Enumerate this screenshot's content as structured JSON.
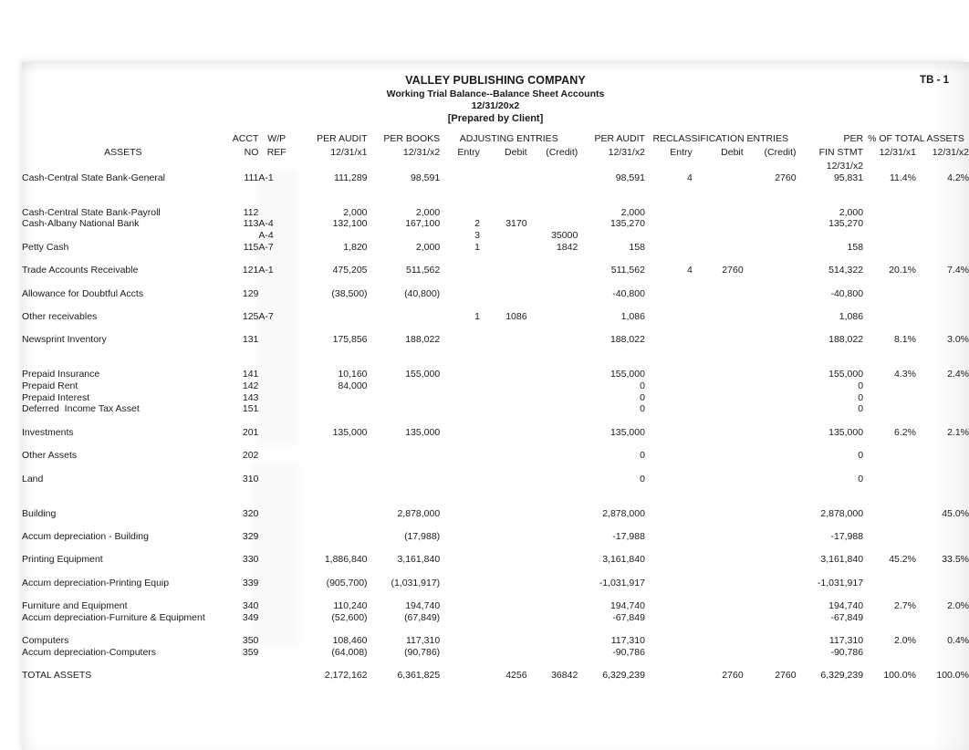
{
  "document": {
    "company": "VALLEY PUBLISHING COMPANY",
    "subtitle": "Working Trial Balance--Balance Sheet Accounts",
    "date": "12/31/20x2",
    "prepared_by": "[Prepared by Client]",
    "page_ref": "TB - 1"
  },
  "headers": {
    "assets": "ASSETS",
    "acct_no_1": "ACCT",
    "acct_no_2": "NO",
    "wp_ref_1": "W/P",
    "wp_ref_2": "REF",
    "per_audit_x1_1": "PER AUDIT",
    "per_audit_x1_2": "12/31/x1",
    "per_books_x2_1": "PER BOOKS",
    "per_books_x2_2": "12/31/x2",
    "adjusting_entries": "ADJUSTING ENTRIES",
    "adj_entry": "Entry",
    "adj_debit": "Debit",
    "adj_credit": "(Credit)",
    "per_audit_x2_1": "PER AUDIT",
    "per_audit_x2_2": "12/31/x2",
    "reclass_entries": "RECLASSIFICATION ENTRIES",
    "recl_entry": "Entry",
    "recl_debit": "Debit",
    "recl_credit": "(Credit)",
    "per_fin_stmt_1": "PER",
    "per_fin_stmt_2": "FIN STMT",
    "per_fin_stmt_3": "12/31/x2",
    "pct_total_assets": "% OF TOTAL ASSETS",
    "pct_x1": "12/31/x1",
    "pct_x2": "12/31/x2"
  },
  "rows": [
    {
      "kind": "data",
      "desc": "Cash-Central State Bank-General",
      "acct": "111",
      "wp": "A-1",
      "pa1": "111,289",
      "pb2": "98,591",
      "ae": "",
      "ad": "",
      "ac": "",
      "pa2": "98,591",
      "re": "4",
      "rd": "",
      "rc": "2760",
      "pfs": "95,831",
      "p1": "11.4%",
      "p2": "4.2%"
    },
    {
      "kind": "gap"
    },
    {
      "kind": "gap"
    },
    {
      "kind": "data",
      "desc": "Cash-Central State Bank-Payroll",
      "acct": "112",
      "wp": "",
      "pa1": "2,000",
      "pb2": "2,000",
      "ae": "",
      "ad": "",
      "ac": "",
      "pa2": "2,000",
      "re": "",
      "rd": "",
      "rc": "",
      "pfs": "2,000",
      "p1": "",
      "p2": ""
    },
    {
      "kind": "data",
      "desc": "Cash-Albany National Bank",
      "acct": "113",
      "wp": "A-4",
      "pa1": "132,100",
      "pb2": "167,100",
      "ae": "2",
      "ad": "3170",
      "ac": "",
      "pa2": "135,270",
      "re": "",
      "rd": "",
      "rc": "",
      "pfs": "135,270",
      "p1": "",
      "p2": ""
    },
    {
      "kind": "data",
      "desc": "",
      "acct": "",
      "wp": "A-4",
      "pa1": "",
      "pb2": "",
      "ae": "3",
      "ad": "",
      "ac": "35000",
      "pa2": "",
      "re": "",
      "rd": "",
      "rc": "",
      "pfs": "",
      "p1": "",
      "p2": ""
    },
    {
      "kind": "data",
      "desc": "Petty Cash",
      "acct": "115",
      "wp": "A-7",
      "pa1": "1,820",
      "pb2": "2,000",
      "ae": "1",
      "ad": "",
      "ac": "1842",
      "pa2": "158",
      "re": "",
      "rd": "",
      "rc": "",
      "pfs": "158",
      "p1": "",
      "p2": ""
    },
    {
      "kind": "gap"
    },
    {
      "kind": "data",
      "desc": "Trade Accounts Receivable",
      "acct": "121",
      "wp": "A-1",
      "pa1": "475,205",
      "pb2": "511,562",
      "ae": "",
      "ad": "",
      "ac": "",
      "pa2": "511,562",
      "re": "4",
      "rd": "2760",
      "rc": "",
      "pfs": "514,322",
      "p1": "20.1%",
      "p2": "7.4%"
    },
    {
      "kind": "gap"
    },
    {
      "kind": "data",
      "desc": "Allowance for Doubtful Accts",
      "acct": "129",
      "wp": "",
      "pa1": "(38,500)",
      "pb2": "(40,800)",
      "ae": "",
      "ad": "",
      "ac": "",
      "pa2": "-40,800",
      "re": "",
      "rd": "",
      "rc": "",
      "pfs": "-40,800",
      "p1": "",
      "p2": ""
    },
    {
      "kind": "gap"
    },
    {
      "kind": "data",
      "desc": "Other receivables",
      "acct": "125",
      "wp": "A-7",
      "pa1": "",
      "pb2": "",
      "ae": "1",
      "ad": "1086",
      "ac": "",
      "pa2": "1,086",
      "re": "",
      "rd": "",
      "rc": "",
      "pfs": "1,086",
      "p1": "",
      "p2": ""
    },
    {
      "kind": "gap"
    },
    {
      "kind": "data",
      "desc": "Newsprint Inventory",
      "acct": "131",
      "wp": "",
      "pa1": "175,856",
      "pb2": "188,022",
      "ae": "",
      "ad": "",
      "ac": "",
      "pa2": "188,022",
      "re": "",
      "rd": "",
      "rc": "",
      "pfs": "188,022",
      "p1": "8.1%",
      "p2": "3.0%"
    },
    {
      "kind": "gap"
    },
    {
      "kind": "gap"
    },
    {
      "kind": "data",
      "desc": "Prepaid Insurance",
      "acct": "141",
      "wp": "",
      "pa1": "10,160",
      "pb2": "155,000",
      "ae": "",
      "ad": "",
      "ac": "",
      "pa2": "155,000",
      "re": "",
      "rd": "",
      "rc": "",
      "pfs": "155,000",
      "p1": "4.3%",
      "p2": "2.4%"
    },
    {
      "kind": "data",
      "desc": "Prepaid Rent",
      "acct": "142",
      "wp": "",
      "pa1": "84,000",
      "pb2": "",
      "ae": "",
      "ad": "",
      "ac": "",
      "pa2": "0",
      "re": "",
      "rd": "",
      "rc": "",
      "pfs": "0",
      "p1": "",
      "p2": ""
    },
    {
      "kind": "data",
      "desc": "Prepaid Interest",
      "acct": "143",
      "wp": "",
      "pa1": "",
      "pb2": "",
      "ae": "",
      "ad": "",
      "ac": "",
      "pa2": "0",
      "re": "",
      "rd": "",
      "rc": "",
      "pfs": "0",
      "p1": "",
      "p2": ""
    },
    {
      "kind": "data",
      "desc": "Deferred  Income Tax Asset",
      "acct": "151",
      "wp": "",
      "pa1": "",
      "pb2": "",
      "ae": "",
      "ad": "",
      "ac": "",
      "pa2": "0",
      "re": "",
      "rd": "",
      "rc": "",
      "pfs": "0",
      "p1": "",
      "p2": ""
    },
    {
      "kind": "gap"
    },
    {
      "kind": "data",
      "desc": "Investments",
      "acct": "201",
      "wp": "",
      "pa1": "135,000",
      "pb2": "135,000",
      "ae": "",
      "ad": "",
      "ac": "",
      "pa2": "135,000",
      "re": "",
      "rd": "",
      "rc": "",
      "pfs": "135,000",
      "p1": "6.2%",
      "p2": "2.1%"
    },
    {
      "kind": "gap"
    },
    {
      "kind": "data",
      "desc": "Other Assets",
      "acct": "202",
      "wp": "",
      "pa1": "",
      "pb2": "",
      "ae": "",
      "ad": "",
      "ac": "",
      "pa2": "0",
      "re": "",
      "rd": "",
      "rc": "",
      "pfs": "0",
      "p1": "",
      "p2": ""
    },
    {
      "kind": "gap"
    },
    {
      "kind": "data",
      "desc": "Land",
      "acct": "310",
      "wp": "",
      "pa1": "",
      "pb2": "",
      "ae": "",
      "ad": "",
      "ac": "",
      "pa2": "0",
      "re": "",
      "rd": "",
      "rc": "",
      "pfs": "0",
      "p1": "",
      "p2": ""
    },
    {
      "kind": "gap"
    },
    {
      "kind": "gap"
    },
    {
      "kind": "data",
      "desc": "Building",
      "acct": "320",
      "wp": "",
      "pa1": "",
      "pb2": "2,878,000",
      "ae": "",
      "ad": "",
      "ac": "",
      "pa2": "2,878,000",
      "re": "",
      "rd": "",
      "rc": "",
      "pfs": "2,878,000",
      "p1": "",
      "p2": "45.0%"
    },
    {
      "kind": "gap"
    },
    {
      "kind": "data",
      "desc": "Accum depreciation - Building",
      "acct": "329",
      "wp": "",
      "pa1": "",
      "pb2": "(17,988)",
      "ae": "",
      "ad": "",
      "ac": "",
      "pa2": "-17,988",
      "re": "",
      "rd": "",
      "rc": "",
      "pfs": "-17,988",
      "p1": "",
      "p2": ""
    },
    {
      "kind": "gap"
    },
    {
      "kind": "data",
      "desc": "Printing Equipment",
      "acct": "330",
      "wp": "",
      "pa1": "1,886,840",
      "pb2": "3,161,840",
      "ae": "",
      "ad": "",
      "ac": "",
      "pa2": "3,161,840",
      "re": "",
      "rd": "",
      "rc": "",
      "pfs": "3,161,840",
      "p1": "45.2%",
      "p2": "33.5%"
    },
    {
      "kind": "gap"
    },
    {
      "kind": "data",
      "desc": "Accum depreciation-Printing Equip",
      "acct": "339",
      "wp": "",
      "pa1": "(905,700)",
      "pb2": "(1,031,917)",
      "ae": "",
      "ad": "",
      "ac": "",
      "pa2": "-1,031,917",
      "re": "",
      "rd": "",
      "rc": "",
      "pfs": "-1,031,917",
      "p1": "",
      "p2": ""
    },
    {
      "kind": "gap"
    },
    {
      "kind": "data",
      "desc": "Furniture and Equipment",
      "acct": "340",
      "wp": "",
      "pa1": "110,240",
      "pb2": "194,740",
      "ae": "",
      "ad": "",
      "ac": "",
      "pa2": "194,740",
      "re": "",
      "rd": "",
      "rc": "",
      "pfs": "194,740",
      "p1": "2.7%",
      "p2": "2.0%"
    },
    {
      "kind": "data",
      "desc": "Accum depreciation-Furniture & Equipment",
      "acct": "349",
      "wp": "",
      "pa1": "(52,600)",
      "pb2": "(67,849)",
      "ae": "",
      "ad": "",
      "ac": "",
      "pa2": "-67,849",
      "re": "",
      "rd": "",
      "rc": "",
      "pfs": "-67,849",
      "p1": "",
      "p2": ""
    },
    {
      "kind": "gap"
    },
    {
      "kind": "data",
      "desc": "Computers",
      "acct": "350",
      "wp": "",
      "pa1": "108,460",
      "pb2": "117,310",
      "ae": "",
      "ad": "",
      "ac": "",
      "pa2": "117,310",
      "re": "",
      "rd": "",
      "rc": "",
      "pfs": "117,310",
      "p1": "2.0%",
      "p2": "0.4%"
    },
    {
      "kind": "data",
      "desc": "Accum depreciation-Computers",
      "acct": "359",
      "wp": "",
      "pa1": "(64,008)",
      "pb2": "(90,786)",
      "ae": "",
      "ad": "",
      "ac": "",
      "pa2": "-90,786",
      "re": "",
      "rd": "",
      "rc": "",
      "pfs": "-90,786",
      "p1": "",
      "p2": ""
    },
    {
      "kind": "gap"
    },
    {
      "kind": "total",
      "desc": "TOTAL ASSETS",
      "acct": "",
      "wp": "",
      "pa1": "2,172,162",
      "pb2": "6,361,825",
      "ae": "",
      "ad": "4256",
      "ac": "36842",
      "pa2": "6,329,239",
      "re": "",
      "rd": "2760",
      "rc": "2760",
      "pfs": "6,329,239",
      "p1": "100.0%",
      "p2": "100.0%"
    }
  ]
}
